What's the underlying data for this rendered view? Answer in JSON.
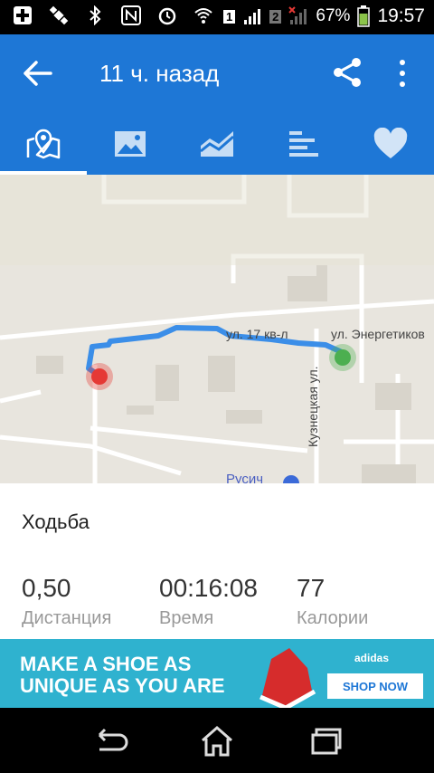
{
  "status_bar": {
    "battery_percent": "67%",
    "time": "19:57",
    "sim1": "1",
    "sim2": "2",
    "icons": [
      "plus-badge-icon",
      "satellite-icon",
      "bluetooth-icon",
      "nfc-icon",
      "alarm-icon",
      "wifi-icon",
      "signal-icon",
      "battery-icon"
    ]
  },
  "app_bar": {
    "title": "11 ч. назад",
    "icons": [
      "back-arrow-icon",
      "share-icon",
      "more-vert-icon"
    ]
  },
  "tabs": [
    {
      "icon": "map-pin-icon",
      "active": true
    },
    {
      "icon": "photo-icon",
      "active": false
    },
    {
      "icon": "chart-area-icon",
      "active": false
    },
    {
      "icon": "bars-icon",
      "active": false
    },
    {
      "icon": "heart-icon",
      "active": false
    }
  ],
  "map": {
    "street_labels": [
      "ул. 17 кв-л",
      "ул. Энергетиков",
      "Кузнецкая ул.",
      "Русич"
    ],
    "start_marker_color": "#4caf50",
    "end_marker_color": "#e53935",
    "route_color": "#3b8ee8"
  },
  "activity": {
    "name": "Ходьба",
    "stats": [
      {
        "value": "0,50",
        "label": "Дистанция"
      },
      {
        "value": "00:16:08",
        "label": "Время"
      },
      {
        "value": "77",
        "label": "Калории"
      }
    ]
  },
  "ad": {
    "line1": "MAKE A SHOE AS",
    "line2": "UNIQUE AS YOU ARE",
    "brand": "adidas",
    "cta": "SHOP NOW"
  },
  "nav_bar": {
    "icons": [
      "back-nav-icon",
      "home-nav-icon",
      "recents-nav-icon"
    ]
  }
}
